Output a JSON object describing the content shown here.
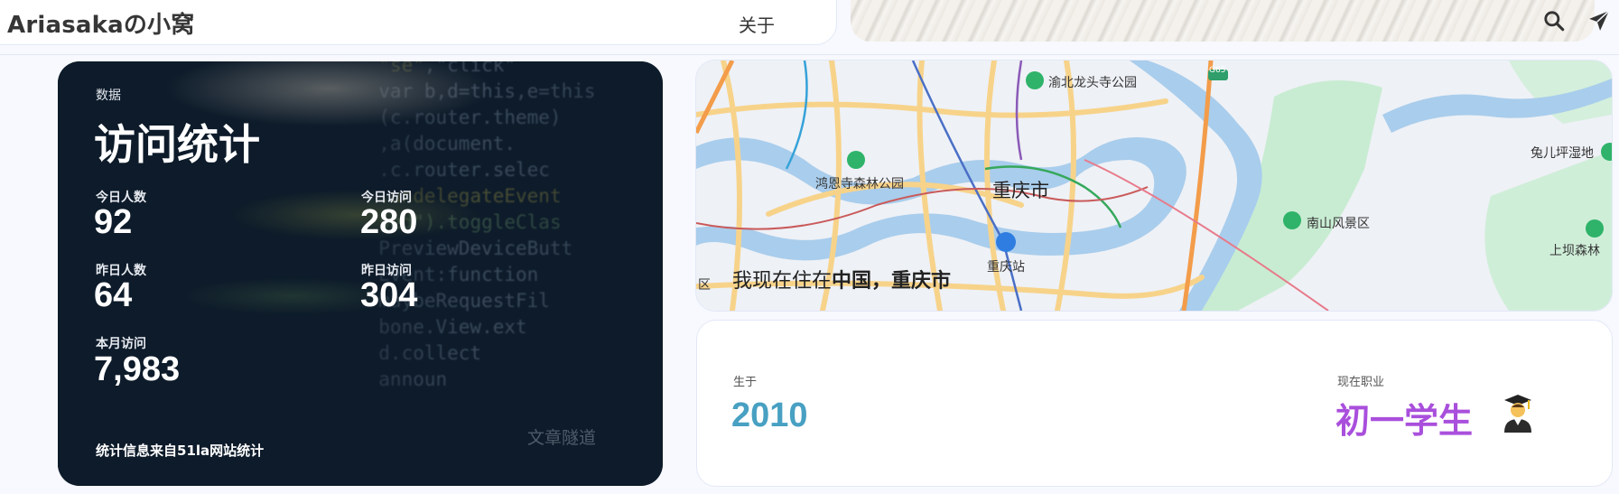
{
  "nav": {
    "site_title": "Ariasakaの小窝",
    "about_label": "关于",
    "icons": [
      "search-icon",
      "paper-plane-icon"
    ]
  },
  "stats": {
    "tag": "数据",
    "title": "访问统计",
    "today_users_label": "今日人数",
    "today_users": "92",
    "today_visits_label": "今日访问",
    "today_visits": "280",
    "yesterday_users_label": "昨日人数",
    "yesterday_users": "64",
    "yesterday_visits_label": "昨日访问",
    "yesterday_visits": "304",
    "month_visits_label": "本月访问",
    "month_visits": "7,983",
    "footer": "统计信息来自51la网站统计",
    "watermark": "文章隧道"
  },
  "map": {
    "caption_prefix": "我现在住在",
    "caption_place": "中国，重庆市",
    "city": "重庆市",
    "labels": {
      "temple": "渝北龙头寺公园",
      "forest_park": "鸿恩寺森林公园",
      "nanshan": "南山风景区",
      "wetland": "兔儿坪湿地",
      "shangba": "上坝森林",
      "station": "重庆站",
      "highway": "G65",
      "edge": "区"
    }
  },
  "info": {
    "born_label": "生于",
    "born_value": "2010",
    "job_label": "现在职业",
    "job_value": "初一学生",
    "job_icon": "student-graduate-icon"
  },
  "colors": {
    "accent_born": "#48a0c2",
    "accent_job": "#a94fdc",
    "card_dark": "#0d1b2a",
    "page_bg": "#f7f9fe"
  }
}
